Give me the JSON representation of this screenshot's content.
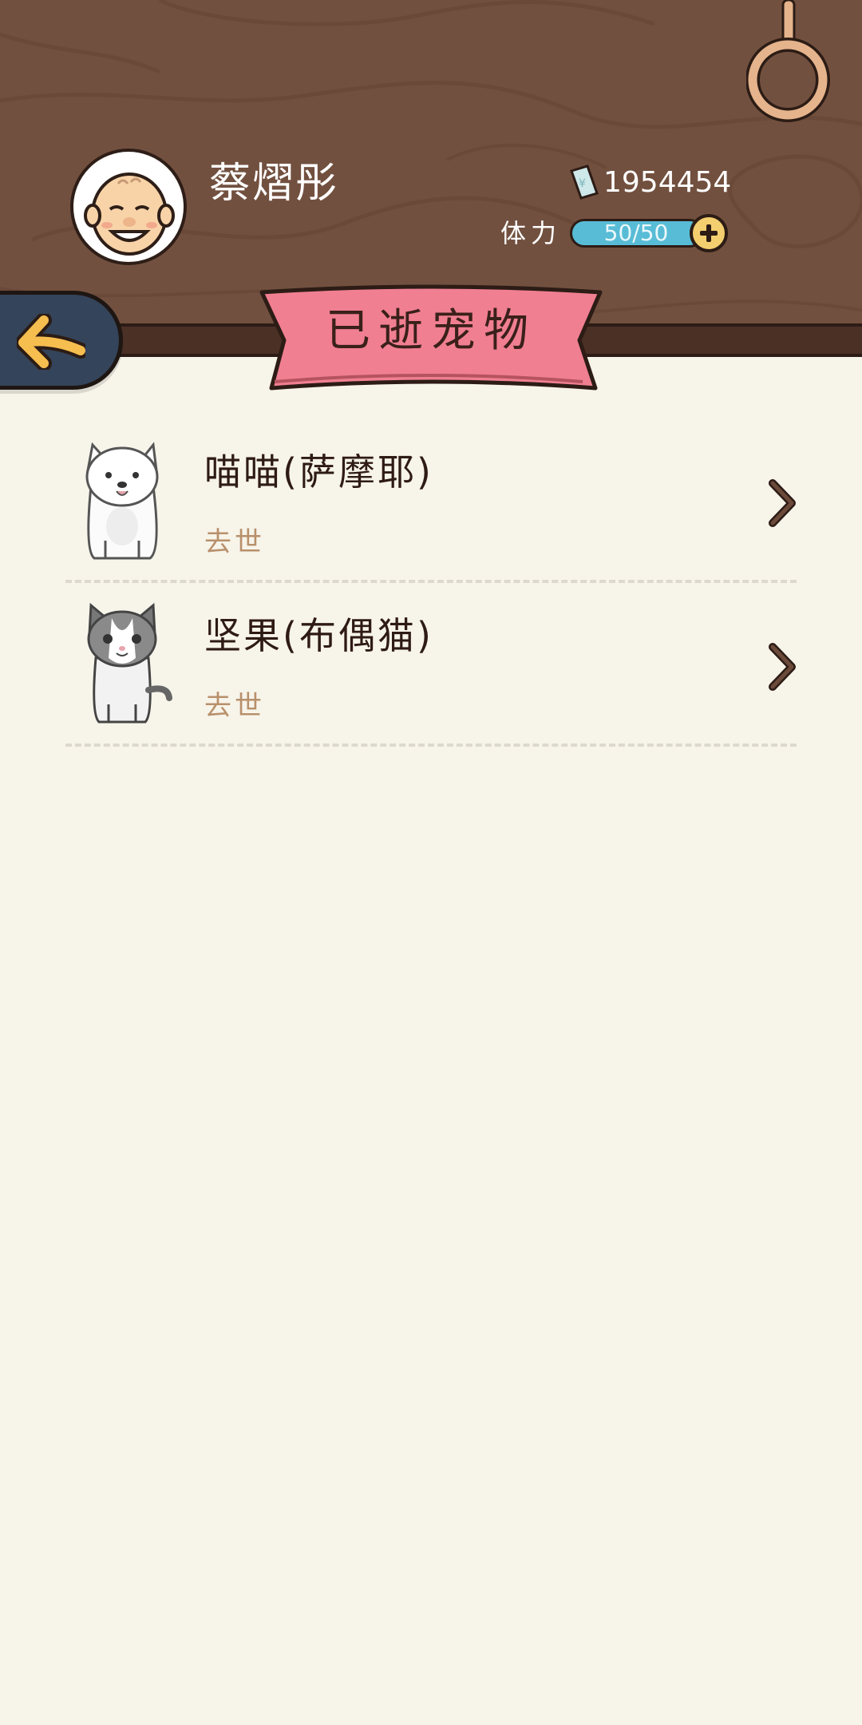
{
  "player": {
    "name": "蔡熠彤",
    "avatar": "old-man-avatar",
    "money": "1954454",
    "stamina_label": "体力",
    "stamina_value": "50/50",
    "stamina_fraction": 1.0
  },
  "header": {
    "title": "已逝宠物",
    "back_icon": "arrow-left-icon",
    "ring_icon": "hanging-ring-icon"
  },
  "pets": [
    {
      "name": "喵喵(萨摩耶)",
      "status": "去世",
      "image": "samoyed-dog"
    },
    {
      "name": "坚果(布偶猫)",
      "status": "去世",
      "image": "ragdoll-cat"
    }
  ],
  "colors": {
    "wood": "#72503f",
    "background": "#f7f4ea",
    "banner": "#f07f91",
    "stamina": "#59bcd6",
    "accent_yellow": "#f4cf6f",
    "back_button": "#34445a"
  }
}
